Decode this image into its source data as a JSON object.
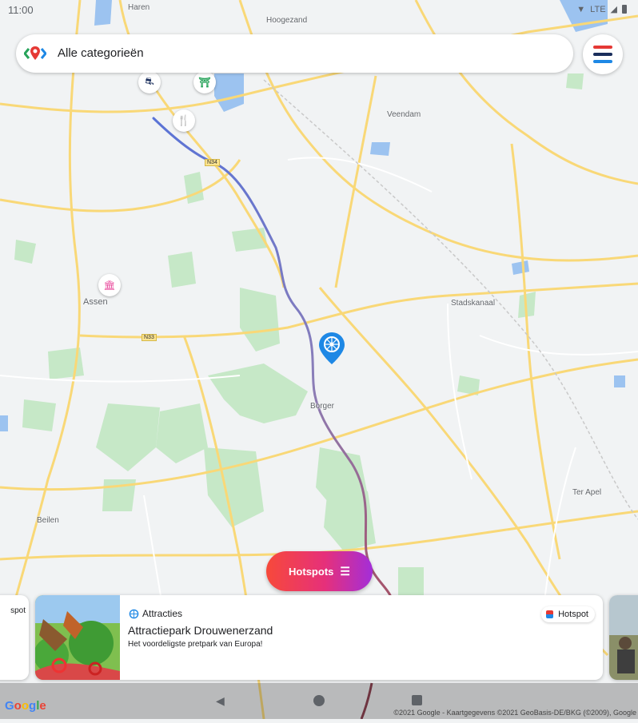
{
  "status_bar": {
    "time": "11:00",
    "network": "LTE"
  },
  "search": {
    "placeholder": "Alle categorieën"
  },
  "map": {
    "place_labels": [
      "Haren",
      "Hoogezand",
      "Veendam",
      "Assen",
      "Stadskanaal",
      "Borger",
      "Beilen",
      "Ter Apel"
    ],
    "road_labels": [
      "N34",
      "N33"
    ]
  },
  "hotspots_button": {
    "label": "Hotspots"
  },
  "card": {
    "category": "Attracties",
    "badge": "Hotspot",
    "title": "Attractiepark Drouwenerzand",
    "description": "Het voordeligste pretpark van Europa!"
  },
  "prev_card": {
    "badge": "spot"
  },
  "footer": {
    "google": "Google",
    "copyright": "©2021 Google - Kaartgegevens ©2021 GeoBasis-DE/BKG (©2009), Google"
  },
  "colors": {
    "accent_gradient_start": "#f7493a",
    "accent_gradient_end": "#a32ed9",
    "marker_blue": "#1e88e5"
  }
}
